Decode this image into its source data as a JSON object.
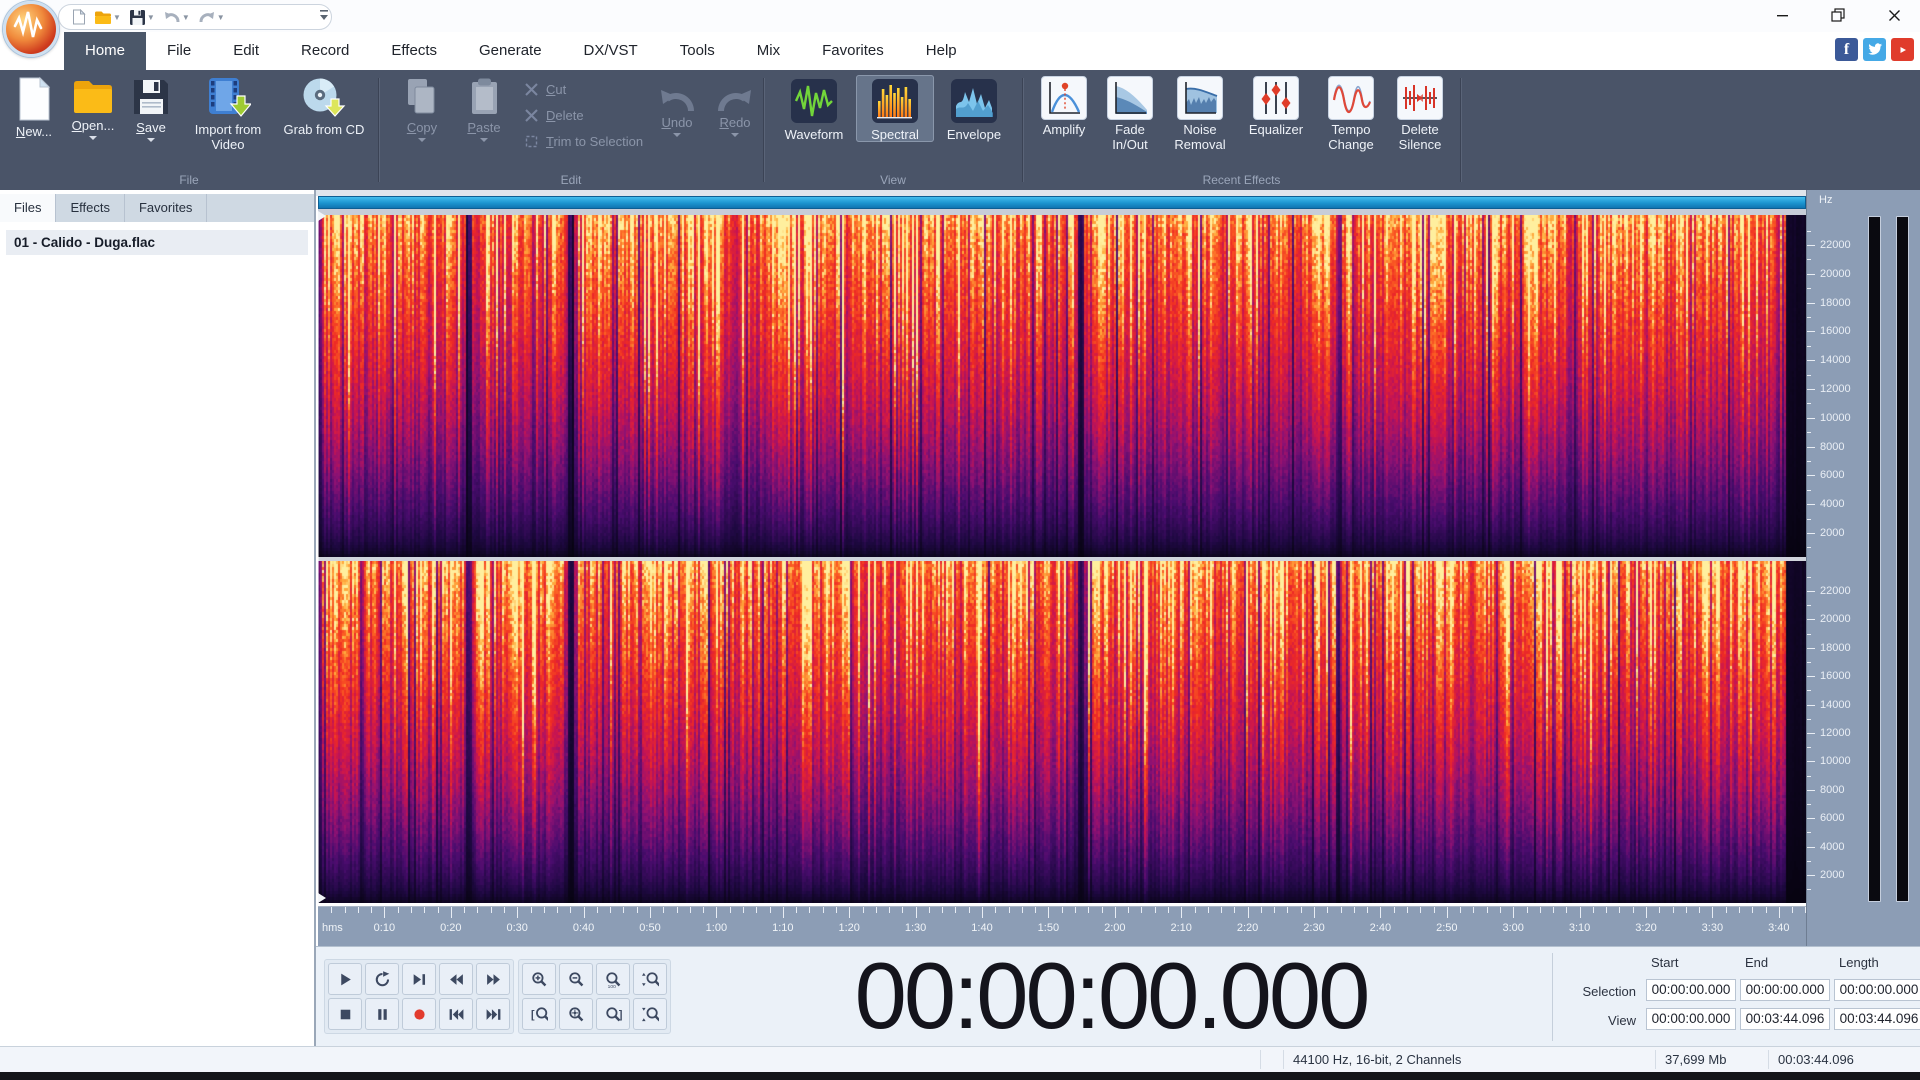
{
  "titlebar": {
    "qat_icons": [
      "new-file-icon",
      "open-folder-icon",
      "save-icon",
      "undo-icon",
      "redo-icon",
      "customize-toolbar-icon"
    ],
    "window_icons": [
      "minimize-icon",
      "maximize-icon",
      "close-icon"
    ]
  },
  "menu": {
    "tabs": [
      "Home",
      "File",
      "Edit",
      "Record",
      "Effects",
      "Generate",
      "DX/VST",
      "Tools",
      "Mix",
      "Favorites",
      "Help"
    ],
    "active_tab": "Home",
    "social_icons": [
      "facebook-icon",
      "twitter-icon",
      "youtube-icon"
    ]
  },
  "ribbon": {
    "file": {
      "new": "New...",
      "open": "Open...",
      "save": "Save",
      "import_video": "Import from Video",
      "grab_cd": "Grab from CD"
    },
    "edit": {
      "copy": "Copy",
      "paste": "Paste",
      "cut": "Cut",
      "del": "Delete",
      "trim": "Trim to Selection",
      "undo": "Undo",
      "redo": "Redo"
    },
    "view": {
      "waveform": "Waveform",
      "spectral": "Spectral",
      "envelope": "Envelope",
      "active": "Spectral"
    },
    "effects": {
      "amplify": "Amplify",
      "fade": "Fade In/Out",
      "noise": "Noise Removal",
      "equalizer": "Equalizer",
      "tempo": "Tempo Change",
      "silence": "Delete Silence"
    },
    "group_labels": {
      "file": "File",
      "edit": "Edit",
      "view": "View",
      "recent": "Recent Effects"
    }
  },
  "sidebar": {
    "tabs": [
      "Files",
      "Effects",
      "Favorites"
    ],
    "active_tab": "Files",
    "files": [
      {
        "name": "01 - Calido - Duga.flac"
      }
    ]
  },
  "spectral_view": {
    "hz_unit": "Hz",
    "freq_labels": [
      "22000",
      "20000",
      "18000",
      "16000",
      "14000",
      "12000",
      "10000",
      "8000",
      "6000",
      "4000",
      "2000"
    ],
    "channels": 2
  },
  "timeline": {
    "unit_label": "hms",
    "total_seconds": 224.096,
    "major_step_seconds": 10,
    "minor_step_seconds": 2,
    "labels": [
      "0:10",
      "0:20",
      "0:30",
      "0:40",
      "0:50",
      "1:00",
      "1:10",
      "1:20",
      "1:30",
      "1:40",
      "1:50",
      "2:00",
      "2:10",
      "2:20",
      "2:30",
      "2:40",
      "2:50",
      "3:00",
      "3:10",
      "3:20",
      "3:30",
      "3:40"
    ]
  },
  "transport_buttons": [
    "play",
    "loop",
    "play-next",
    "rewind",
    "fast-forward",
    "stop",
    "pause",
    "record",
    "go-start",
    "go-end"
  ],
  "zoom_buttons": [
    "zoom-in",
    "zoom-out",
    "zoom-100",
    "zoom-vertical-in",
    "zoom-selection-start",
    "zoom-center",
    "zoom-selection-end",
    "zoom-vertical-out"
  ],
  "time_display": {
    "value": "00:00:00.000"
  },
  "position_panel": {
    "col_headers": [
      "Start",
      "End",
      "Length"
    ],
    "rows": [
      {
        "label": "Selection",
        "start": "00:00:00.000",
        "end": "00:00:00.000",
        "length": "00:00:00.000"
      },
      {
        "label": "View",
        "start": "00:00:00.000",
        "end": "00:03:44.096",
        "length": "00:03:44.096"
      }
    ]
  },
  "status_bar": {
    "audio_format": "44100 Hz, 16-bit, 2 Channels",
    "file_size": "37,699 Mb",
    "duration": "00:03:44.096"
  },
  "colors": {
    "accent_blue": "#1b94cf",
    "ribbon_bg": "#4a5468",
    "ruler_bg": "#8c9db5",
    "record_red": "#e23b2e",
    "spectrogram_ramp": [
      [
        0.0,
        "#06030f"
      ],
      [
        0.14,
        "#1d0840"
      ],
      [
        0.3,
        "#4a0c6e"
      ],
      [
        0.45,
        "#8e1173"
      ],
      [
        0.58,
        "#c81450"
      ],
      [
        0.72,
        "#ee2a24"
      ],
      [
        0.84,
        "#fb6023"
      ],
      [
        0.93,
        "#ffad3f"
      ],
      [
        1.0,
        "#ffef9e"
      ]
    ]
  }
}
